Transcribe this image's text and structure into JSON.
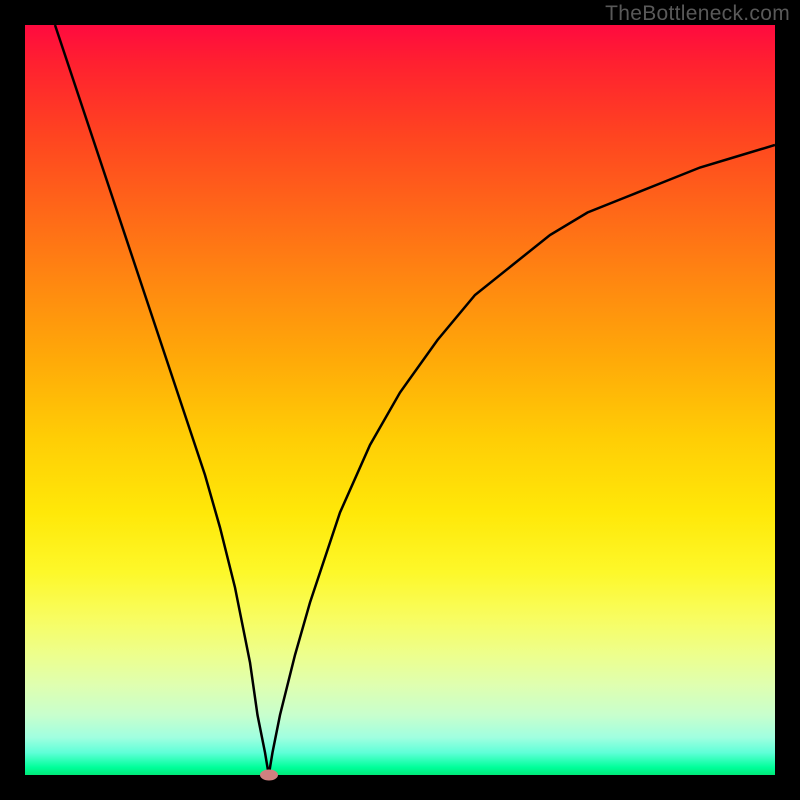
{
  "watermark": "TheBottleneck.com",
  "chart_data": {
    "type": "line",
    "title": "",
    "xlabel": "",
    "ylabel": "",
    "xlim": [
      0,
      100
    ],
    "ylim": [
      0,
      100
    ],
    "series": [
      {
        "name": "bottleneck-curve",
        "x": [
          4,
          8,
          12,
          16,
          20,
          24,
          26,
          28,
          30,
          31,
          32,
          32.5,
          33,
          34,
          36,
          38,
          42,
          46,
          50,
          55,
          60,
          65,
          70,
          75,
          80,
          85,
          90,
          95,
          100
        ],
        "values": [
          100,
          88,
          76,
          64,
          52,
          40,
          33,
          25,
          15,
          8,
          3,
          0,
          3,
          8,
          16,
          23,
          35,
          44,
          51,
          58,
          64,
          68,
          72,
          75,
          77,
          79,
          81,
          82.5,
          84
        ]
      }
    ],
    "marker": {
      "x": 32.5,
      "y": 0
    },
    "gradient_colors": {
      "top": "#ff0a3f",
      "bottom": "#00e878"
    }
  }
}
